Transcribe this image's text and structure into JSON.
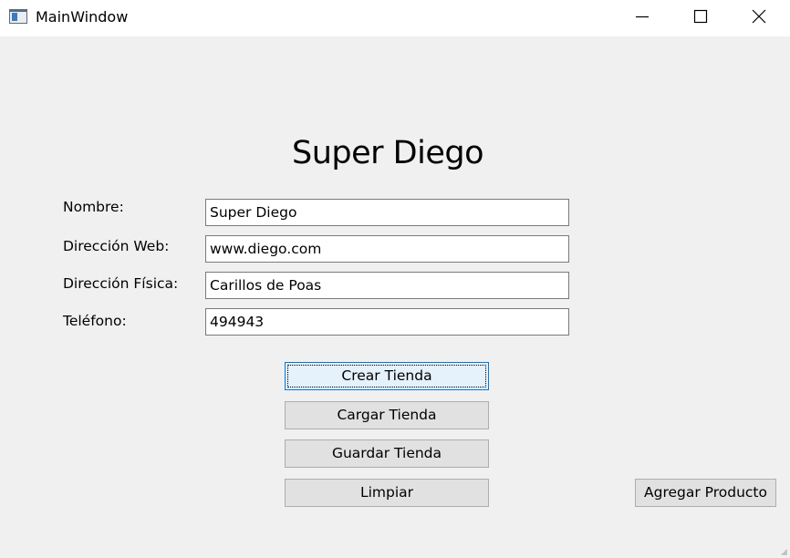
{
  "window": {
    "title": "MainWindow"
  },
  "icons": {
    "app": "window-app-icon",
    "minimize": "minimize-icon",
    "maximize": "maximize-icon",
    "close": "close-icon"
  },
  "heading": "Super Diego",
  "form": {
    "nombre": {
      "label": "Nombre:",
      "value": "Super Diego"
    },
    "web": {
      "label": "Dirección Web:",
      "value": "www.diego.com"
    },
    "fisica": {
      "label": "Dirección Física:",
      "value": "Carillos de Poas"
    },
    "telefono": {
      "label": "Teléfono:",
      "value": "494943"
    }
  },
  "buttons": {
    "crear": "Crear Tienda",
    "cargar": "Cargar Tienda",
    "guardar": "Guardar Tienda",
    "limpiar": "Limpiar",
    "agregar_producto": "Agregar Producto"
  },
  "colors": {
    "window_bg": "#f0f0f0",
    "button_bg": "#e1e1e1",
    "focus_border": "#0078d7",
    "focus_bg": "#e5f1fb"
  }
}
